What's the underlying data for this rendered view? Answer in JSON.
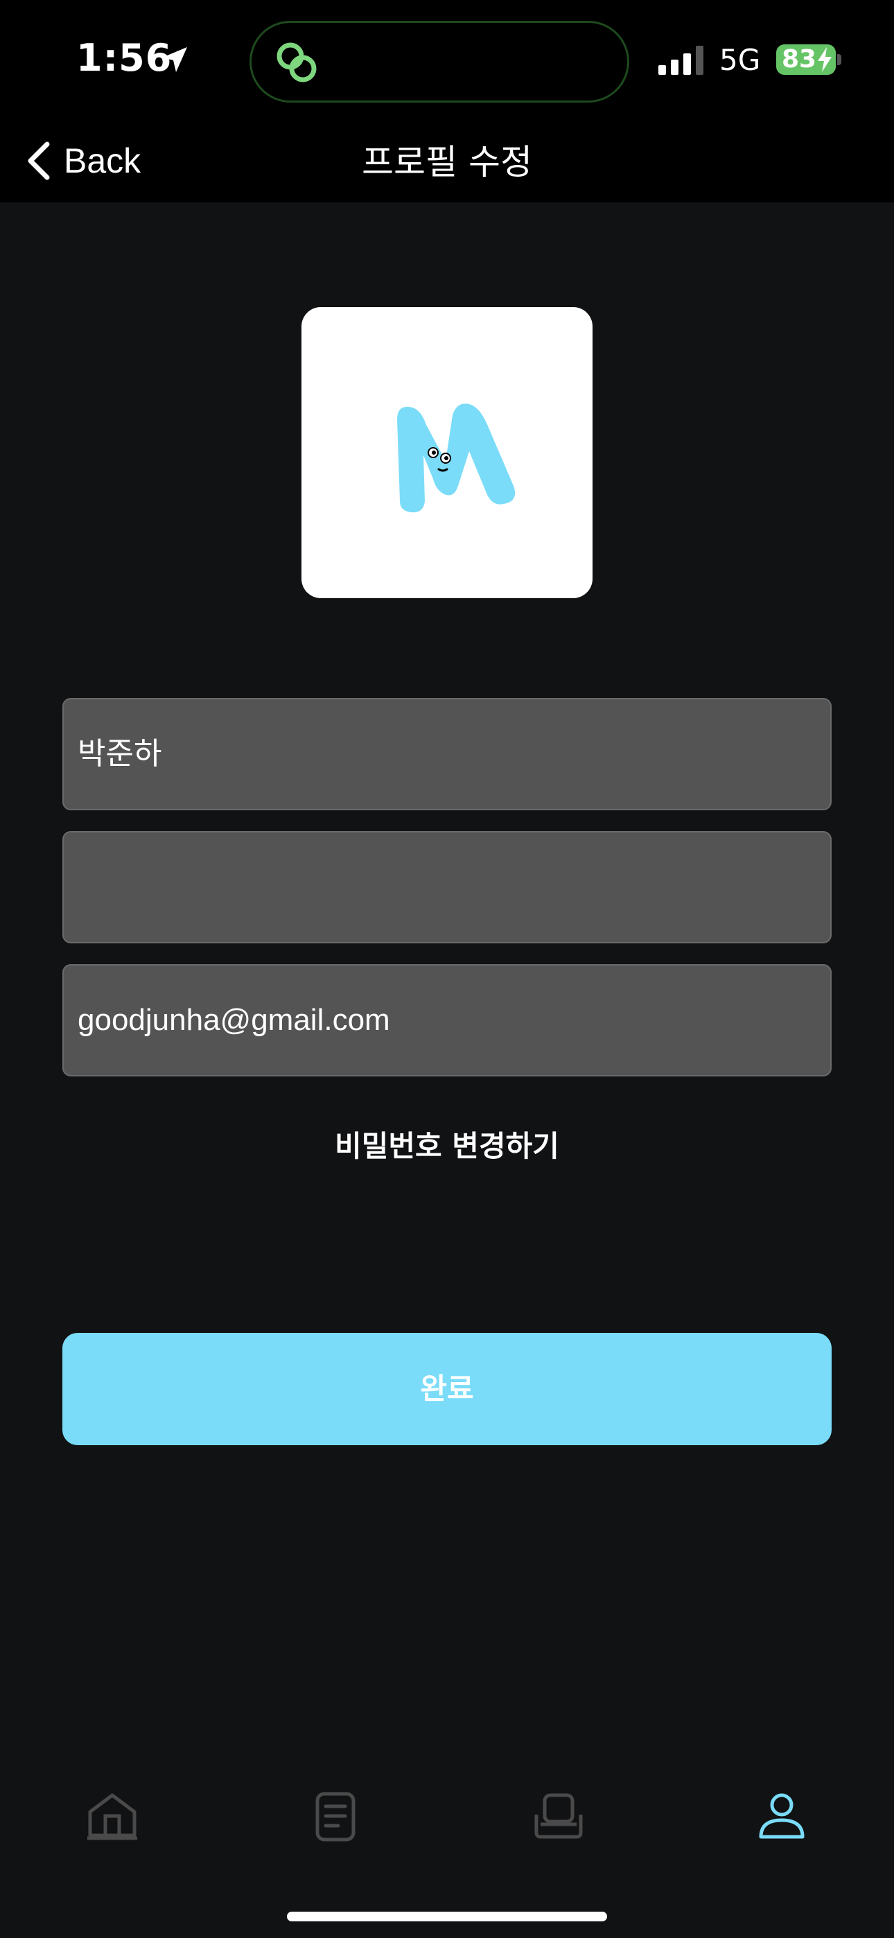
{
  "status_bar": {
    "time": "1:56",
    "network": "5G",
    "battery": "83"
  },
  "nav": {
    "back_label": "Back",
    "title": "프로필 수정"
  },
  "profile": {
    "avatar_letter": "M",
    "avatar_color": "#7adcf8"
  },
  "form": {
    "name_value": "박준하",
    "second_value": "",
    "email_value": "goodjunha@gmail.com",
    "change_password_label": "비밀번호 변경하기",
    "done_label": "완료"
  },
  "tab_bar": {
    "items": [
      {
        "icon": "home-icon",
        "active": false
      },
      {
        "icon": "document-icon",
        "active": false
      },
      {
        "icon": "seat-icon",
        "active": false
      },
      {
        "icon": "profile-icon",
        "active": true
      }
    ],
    "active_color": "#7adcf8",
    "inactive_color": "#4a4a4a"
  }
}
